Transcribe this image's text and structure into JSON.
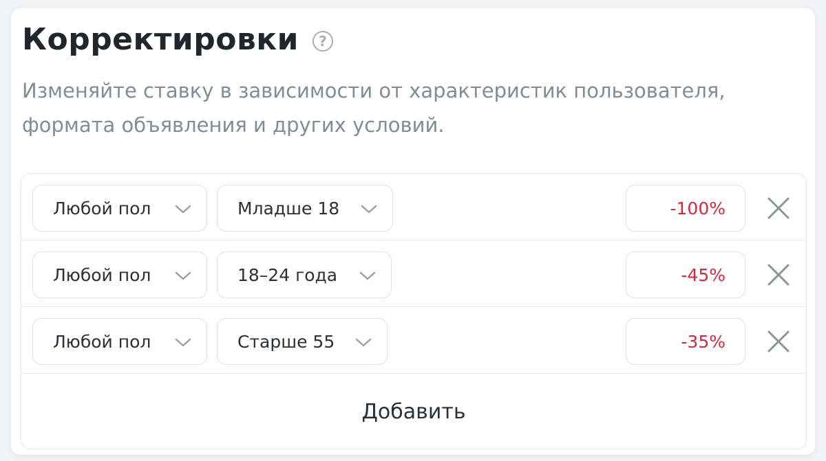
{
  "header": {
    "title": "Корректировки",
    "help_icon": "question-circle-icon",
    "description": "Изменяйте ставку в зависимости от характеристик пользователя, формата объявления и других условий."
  },
  "rows": [
    {
      "gender": "Любой пол",
      "age": "Младше 18",
      "percent": "-100%"
    },
    {
      "gender": "Любой пол",
      "age": "18–24 года",
      "percent": "-45%"
    },
    {
      "gender": "Любой пол",
      "age": "Старше 55",
      "percent": "-35%"
    }
  ],
  "add_label": "Добавить",
  "colors": {
    "title": "#21262d",
    "description": "#858b95",
    "negative_value": "#d8263b",
    "border": "#dde0e5"
  }
}
